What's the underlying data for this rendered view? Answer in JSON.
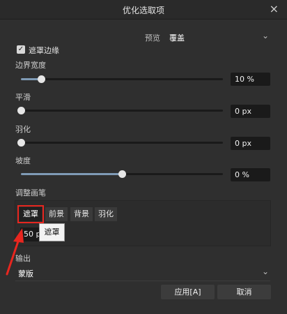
{
  "window": {
    "title": "优化选取项",
    "close_glyph": "×"
  },
  "preview": {
    "label": "预览",
    "value": "覆盖"
  },
  "mask_edges": {
    "label": "遮罩边缘",
    "checked": true
  },
  "sliders": [
    {
      "label": "边界宽度",
      "value_text": "10 %",
      "fraction": 0.1
    },
    {
      "label": "平滑",
      "value_text": "0 px",
      "fraction": 0.0
    },
    {
      "label": "羽化",
      "value_text": "0 px",
      "fraction": 0.0
    },
    {
      "label": "坡度",
      "value_text": "0 %",
      "fraction": 0.5
    }
  ],
  "brush": {
    "title": "调整画笔",
    "tabs": [
      {
        "label": "遮罩",
        "active": true
      },
      {
        "label": "前景",
        "active": false
      },
      {
        "label": "背景",
        "active": false
      },
      {
        "label": "羽化",
        "active": false
      }
    ],
    "size_text": "50 px",
    "tooltip": "遮罩"
  },
  "output": {
    "label": "输出",
    "value": "蒙版"
  },
  "buttons": {
    "apply": "应用[A]",
    "cancel": "取消"
  },
  "colors": {
    "highlight": "#e8261f",
    "slider_fill": "#7f9bb6",
    "background": "#2f2f2f"
  }
}
